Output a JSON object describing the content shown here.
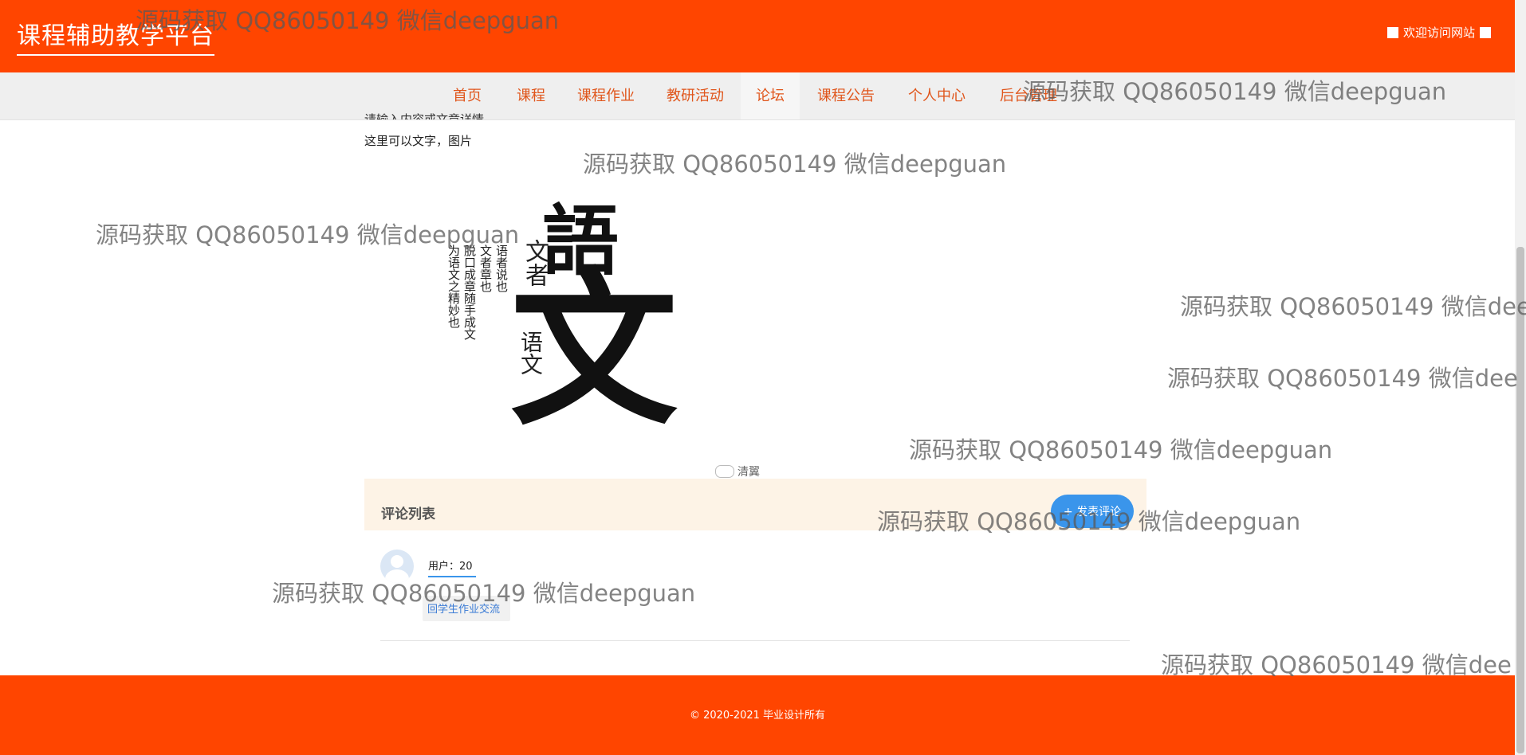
{
  "header": {
    "brand": "课程辅助教学平台",
    "welcome": "欢迎访问网站"
  },
  "nav": {
    "items": [
      {
        "label": "首页"
      },
      {
        "label": "课程"
      },
      {
        "label": "课程作业"
      },
      {
        "label": "教研活动"
      },
      {
        "label": "论坛",
        "active": true
      },
      {
        "label": "课程公告"
      },
      {
        "label": "个人中心"
      },
      {
        "label": "后台管理"
      }
    ]
  },
  "article": {
    "cut_line": "请输入内容或文章详情",
    "text_line": "这里可以文字，图片",
    "poster": {
      "char1": "語",
      "char2": "文",
      "small_a": "文者",
      "small_b": "语文",
      "col1": "语者说也",
      "col2": "文者章也",
      "col3": "脱口成章随手成文",
      "col4": "为语文之精妙也"
    },
    "credit": "清翼"
  },
  "comments": {
    "title": "评论列表",
    "button_label": "+ 发表评论",
    "user_label": "用户：20",
    "reply_text": "回学生作业交流"
  },
  "footer": {
    "copyright": "© 2020-2021 毕业设计所有"
  },
  "watermark": {
    "text": "源码获取 QQ86050149 微信deepguan",
    "text_cut": "源码获取 QQ86050149 微信dee",
    "text_cut2": "源码获取 QQ86050149 微信dee"
  }
}
